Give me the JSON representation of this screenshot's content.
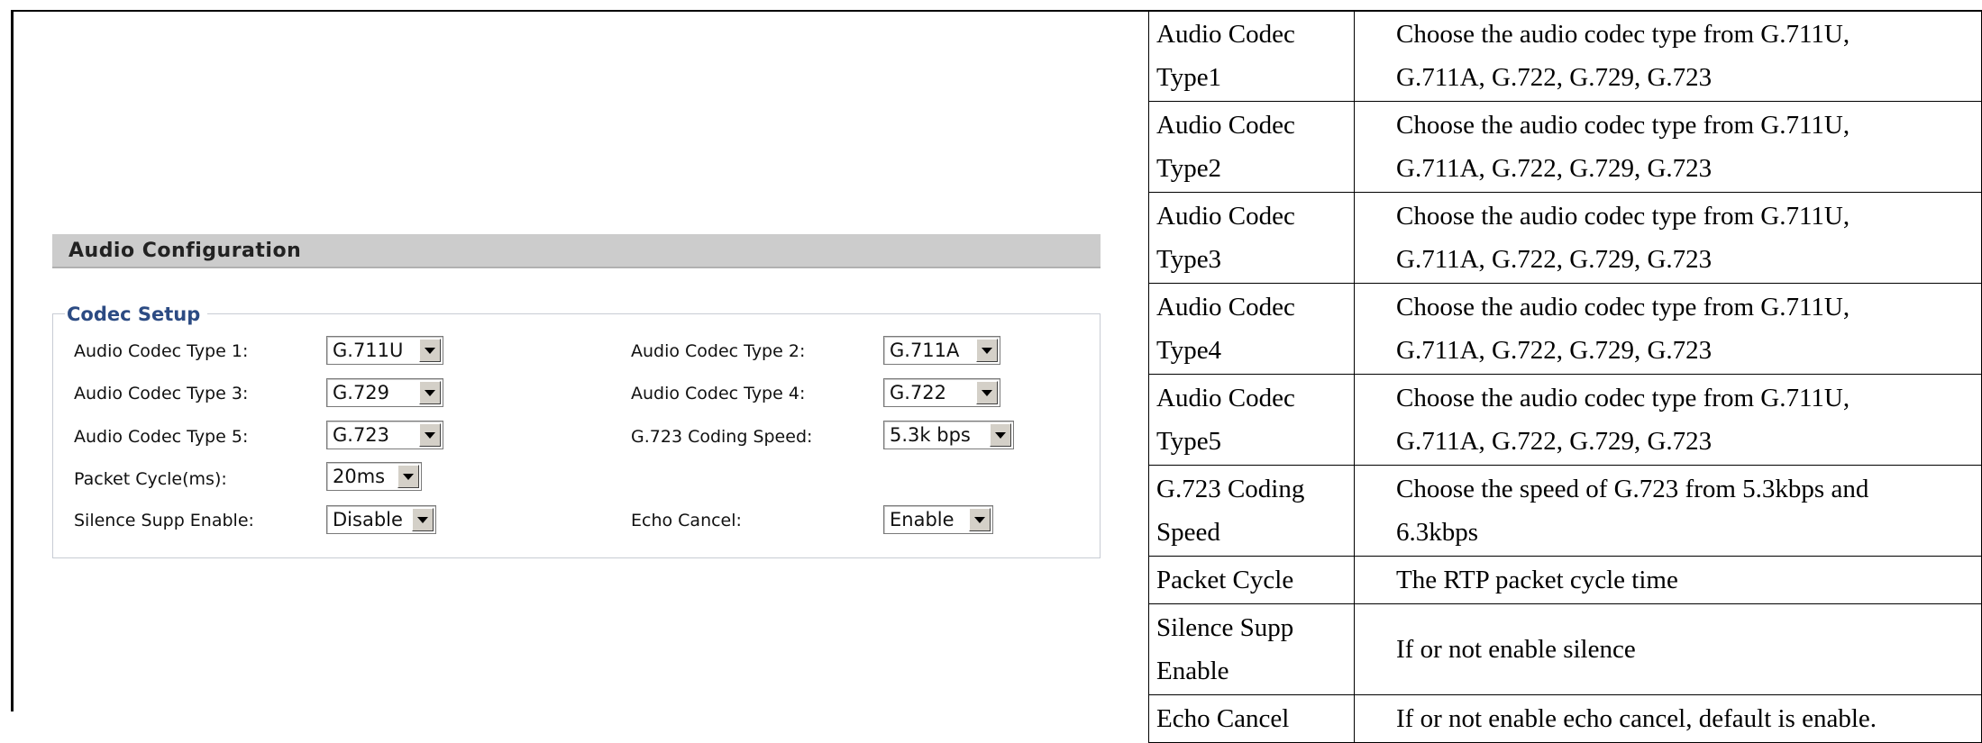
{
  "audio_config": {
    "section_title": "Audio Configuration",
    "codec_setup_legend": "Codec Setup",
    "fields": {
      "codec1": {
        "label": "Audio Codec Type 1:",
        "value": "G.711U"
      },
      "codec2": {
        "label": "Audio Codec Type 2:",
        "value": "G.711A"
      },
      "codec3": {
        "label": "Audio Codec Type 3:",
        "value": "G.729"
      },
      "codec4": {
        "label": "Audio Codec Type 4:",
        "value": "G.722"
      },
      "codec5": {
        "label": "Audio Codec Type 5:",
        "value": "G.723"
      },
      "g723_speed": {
        "label": "G.723 Coding Speed:",
        "value": "5.3k bps"
      },
      "packet_cycle": {
        "label": "Packet Cycle(ms):",
        "value": "20ms"
      },
      "silence_supp": {
        "label": "Silence Supp Enable:",
        "value": "Disable"
      },
      "echo_cancel": {
        "label": "Echo Cancel:",
        "value": "Enable"
      }
    }
  },
  "description_table": {
    "rows": [
      {
        "name_line1": "Audio Codec",
        "name_line2": "Type1",
        "desc_line1": "Choose the audio codec type from G.711U,",
        "desc_line2": "G.711A, G.722, G.729, G.723"
      },
      {
        "name_line1": "Audio Codec",
        "name_line2": "Type2",
        "desc_line1": "Choose the audio codec type from G.711U,",
        "desc_line2": "G.711A, G.722, G.729, G.723"
      },
      {
        "name_line1": "Audio Codec",
        "name_line2": "Type3",
        "desc_line1": "Choose the audio codec type from G.711U,",
        "desc_line2": "G.711A, G.722, G.729, G.723"
      },
      {
        "name_line1": "Audio Codec",
        "name_line2": "Type4",
        "desc_line1": "Choose the audio codec type from G.711U,",
        "desc_line2": "G.711A, G.722, G.729, G.723"
      },
      {
        "name_line1": "Audio Codec",
        "name_line2": "Type5",
        "desc_line1": "Choose the audio codec type from G.711U,",
        "desc_line2": "G.711A, G.722, G.729, G.723"
      },
      {
        "name_line1": "G.723 Coding",
        "name_line2": "Speed",
        "desc_line1": "Choose the speed of G.723 from 5.3kbps and",
        "desc_line2": "6.3kbps"
      },
      {
        "name_line1": "Packet Cycle",
        "desc_line1": "The RTP packet cycle time"
      },
      {
        "name_line1": "Silence Supp",
        "name_line2": "Enable",
        "desc_line1": "If or not enable silence"
      },
      {
        "name_line1": "Echo Cancel",
        "desc_line1": "If or not enable echo cancel, default is enable."
      }
    ]
  }
}
